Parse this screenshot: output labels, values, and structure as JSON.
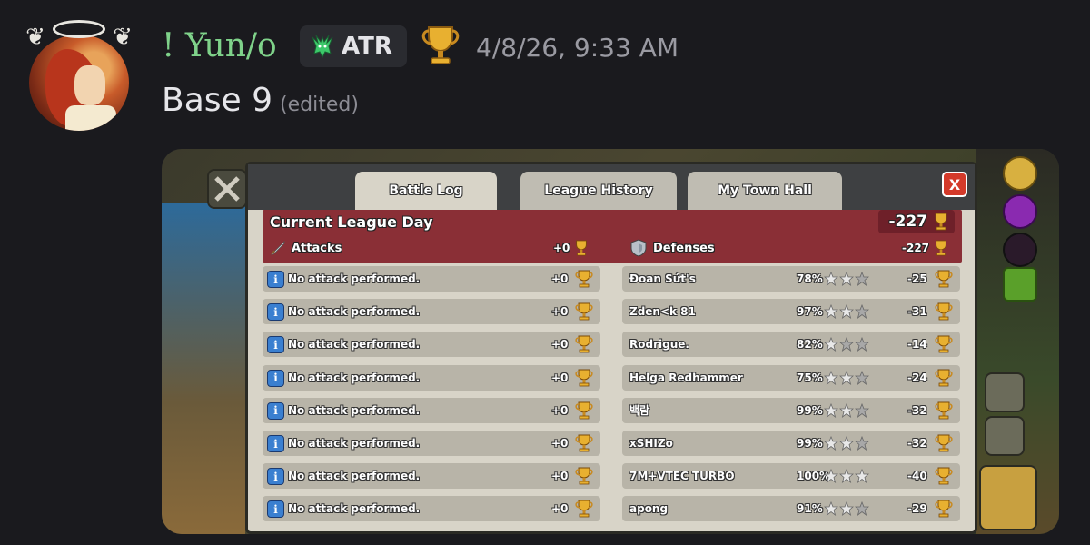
{
  "message": {
    "username": "! Yun/o",
    "tag": "ATR",
    "timestamp": "4/8/26, 9:33 AM",
    "text": "Base 9",
    "edited": "(edited)",
    "colors": {
      "username": "#7fd28a",
      "tag_icon": "#3cc86a"
    }
  },
  "game": {
    "tabs": [
      {
        "label": "Battle Log",
        "active": true
      },
      {
        "label": "League History",
        "active": false
      },
      {
        "label": "My Town Hall",
        "active": false
      }
    ],
    "close_label": "X",
    "league": {
      "title": "Current League Day",
      "total": "-227",
      "attacks_label": "Attacks",
      "attacks_total": "+0",
      "defenses_label": "Defenses",
      "defenses_total": "-227"
    },
    "attacks": [
      {
        "text": "No attack performed.",
        "value": "+0"
      },
      {
        "text": "No attack performed.",
        "value": "+0"
      },
      {
        "text": "No attack performed.",
        "value": "+0"
      },
      {
        "text": "No attack performed.",
        "value": "+0"
      },
      {
        "text": "No attack performed.",
        "value": "+0"
      },
      {
        "text": "No attack performed.",
        "value": "+0"
      },
      {
        "text": "No attack performed.",
        "value": "+0"
      },
      {
        "text": "No attack performed.",
        "value": "+0"
      }
    ],
    "defenses": [
      {
        "name": "Đoan Sứt's",
        "percent": "78%",
        "stars": 2,
        "value": "-25"
      },
      {
        "name": "Zden<k 81",
        "percent": "97%",
        "stars": 2,
        "value": "-31"
      },
      {
        "name": "Rodrigue.",
        "percent": "82%",
        "stars": 1,
        "value": "-14"
      },
      {
        "name": "Helga Redhammer",
        "percent": "75%",
        "stars": 2,
        "value": "-24"
      },
      {
        "name": "백람",
        "percent": "99%",
        "stars": 2,
        "value": "-32"
      },
      {
        "name": "xSHIZo",
        "percent": "99%",
        "stars": 2,
        "value": "-32"
      },
      {
        "name": "7M+VTEC TURBO",
        "percent": "100%",
        "stars": 3,
        "value": "-40"
      },
      {
        "name": "apong",
        "percent": "91%",
        "stars": 2,
        "value": "-29"
      }
    ]
  }
}
